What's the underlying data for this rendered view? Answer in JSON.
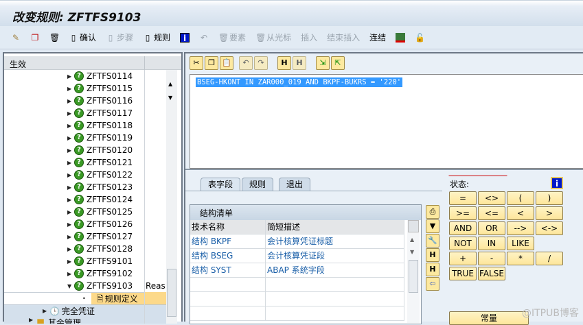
{
  "title": "改变规则: ZFTFS9103",
  "toolbar": {
    "confirm": "确认",
    "step": "步骤",
    "rule": "规则",
    "element": "要素",
    "from_cursor": "从光标",
    "insert": "插入",
    "end_insert": "结束插入",
    "link": "连结"
  },
  "tree": {
    "header": "生效",
    "items": [
      "ZFTFS0114",
      "ZFTFS0115",
      "ZFTFS0116",
      "ZFTFS0117",
      "ZFTFS0118",
      "ZFTFS0119",
      "ZFTFS0120",
      "ZFTFS0121",
      "ZFTFS0122",
      "ZFTFS0123",
      "ZFTFS0124",
      "ZFTFS0125",
      "ZFTFS0126",
      "ZFTFS0127",
      "ZFTFS0128",
      "ZFTFS9101",
      "ZFTFS9102",
      "ZFTFS9103"
    ],
    "selected_desc": "Reaso",
    "child": "规则定义",
    "next": "完全凭证",
    "next2": "其余管理"
  },
  "editor": {
    "code": "BSEG-HKONT IN ZAR000_019 AND BKPF-BUKRS = '220'"
  },
  "tabs": [
    "表字段",
    "规则",
    "退出"
  ],
  "table": {
    "title": "结构清单",
    "columns": [
      "技术名称",
      "简短描述"
    ],
    "rows": [
      [
        "结构 BKPF",
        "会计核算凭证标题"
      ],
      [
        "结构 BSEG",
        "会计核算凭证段"
      ],
      [
        "结构 SYST",
        "ABAP 系统字段"
      ]
    ]
  },
  "status_label": "状态:",
  "operators": [
    [
      "=",
      "<>",
      "(",
      ")"
    ],
    [
      ">=",
      "<=",
      "<",
      ">"
    ],
    [
      "AND",
      "OR",
      "-->",
      "<->"
    ],
    [
      "NOT",
      "IN",
      "LIKE"
    ],
    [
      "+",
      "-",
      "*",
      "/"
    ],
    [
      "TRUE",
      "FALSE"
    ]
  ],
  "constant": "常量",
  "watermark": "@ITPUB博客"
}
